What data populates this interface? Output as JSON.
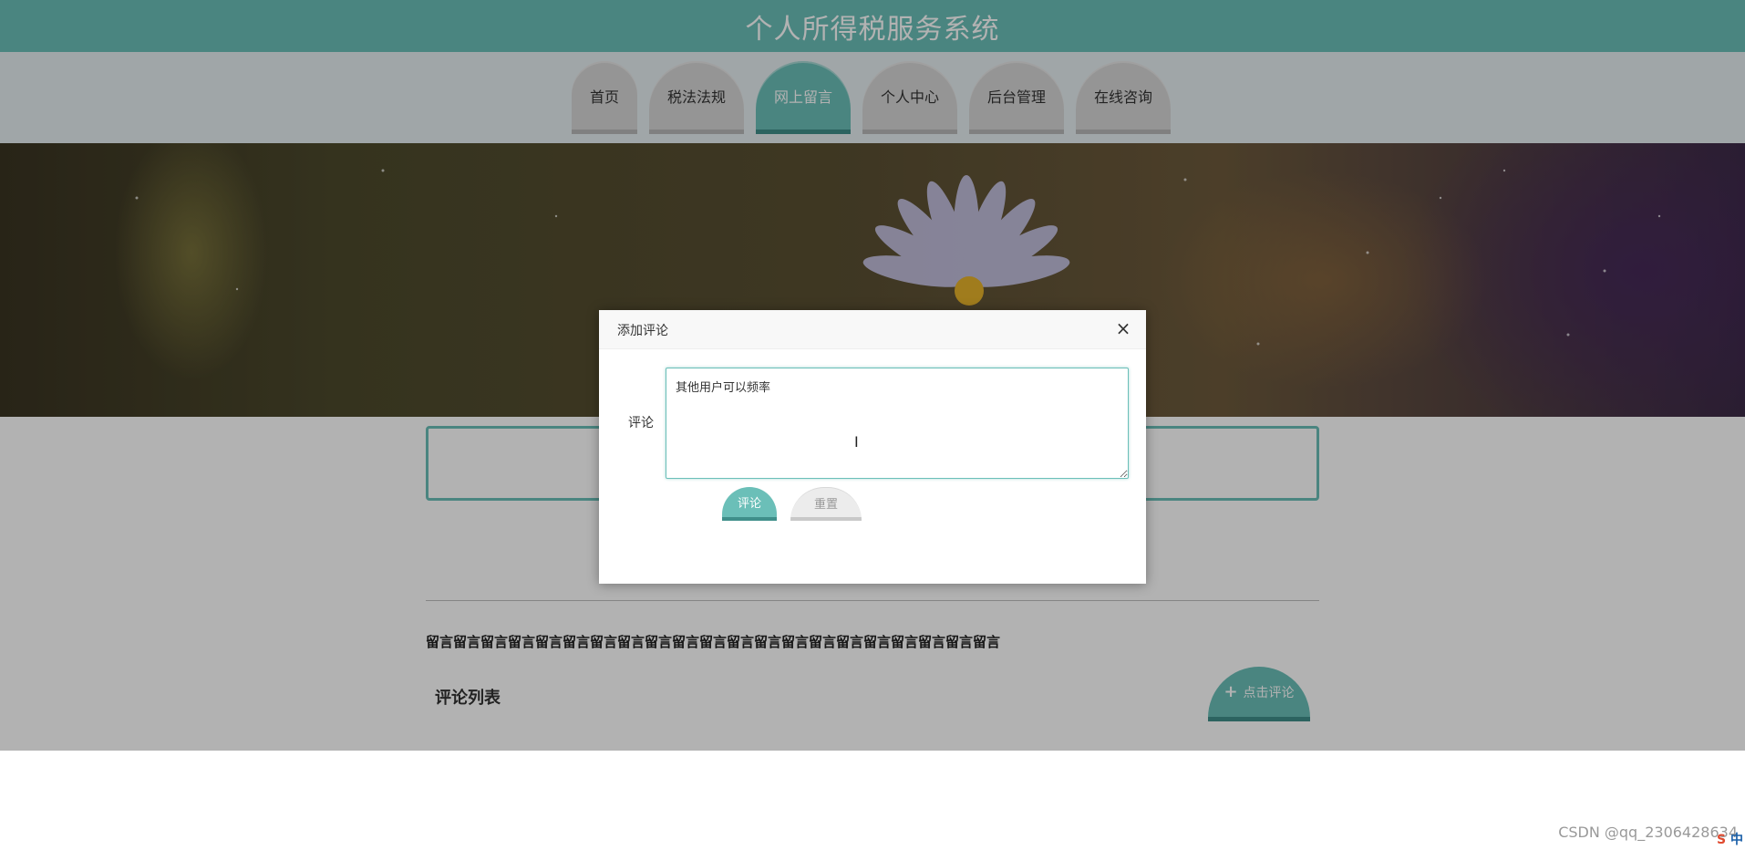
{
  "header": {
    "title": "个人所得税服务系统"
  },
  "nav": {
    "items": [
      {
        "label": "首页",
        "active": false
      },
      {
        "label": "税法法规",
        "active": false
      },
      {
        "label": "网上留言",
        "active": true
      },
      {
        "label": "个人中心",
        "active": false
      },
      {
        "label": "后台管理",
        "active": false
      },
      {
        "label": "在线咨询",
        "active": false
      }
    ]
  },
  "content": {
    "message_text": "留言留言留言留言留言留言留言留言留言留言留言留言留言留言留言留言留言留言留言留言留言",
    "comment_list_title": "评论列表",
    "click_comment_label": "点击评论"
  },
  "modal": {
    "title": "添加评论",
    "close_symbol": "×",
    "comment_label": "评论",
    "comment_value": "其他用户可以频率",
    "submit_label": "评论",
    "reset_label": "重置"
  },
  "footer": {
    "watermark": "CSDN @qq_2306428634",
    "ime_label": "中"
  },
  "colors": {
    "accent": "#6bbfb8",
    "accent_dark": "#3f8f8a"
  }
}
